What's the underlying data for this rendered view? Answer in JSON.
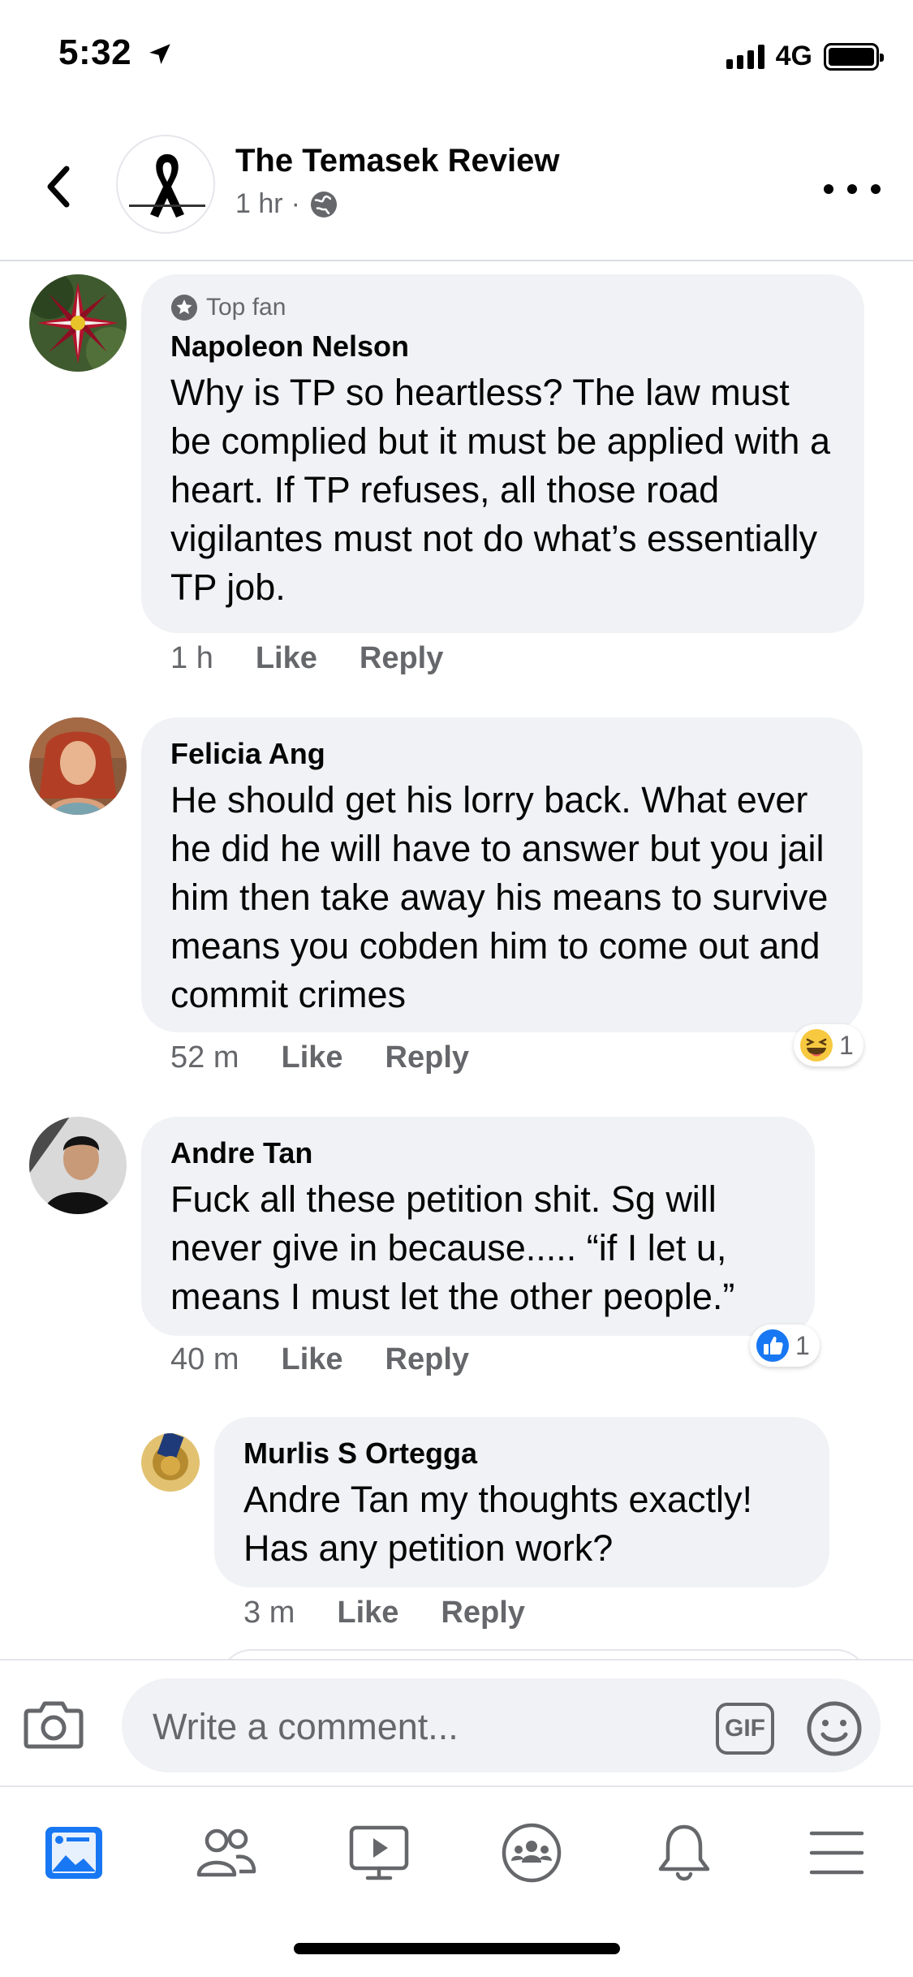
{
  "status_bar": {
    "time": "5:32",
    "network": "4G"
  },
  "header": {
    "page_name": "The Temasek Review",
    "post_time": "1 hr",
    "separator": "·",
    "icons": {
      "back": "chevron-left-icon",
      "privacy": "globe-icon",
      "more": "more-dots-icon"
    }
  },
  "comments": [
    {
      "badge": "Top fan",
      "author": "Napoleon Nelson",
      "text": "Why is TP so heartless? The law must be complied but it must be applied with a heart. If TP refuses,  all those road vigilantes must not do what’s essentially TP job.",
      "time": "1 h",
      "like_label": "Like",
      "reply_label": "Reply"
    },
    {
      "author": "Felicia Ang",
      "text": "He should get his lorry back. What ever he did he will have to answer but you jail him then take away his means to survive means you cobden him to come out and commit crimes",
      "time": "52 m",
      "like_label": "Like",
      "reply_label": "Reply",
      "reaction": {
        "type": "haha",
        "count": "1"
      }
    },
    {
      "author": "Andre Tan",
      "text": "Fuck all these petition shit. Sg will never give in because..... “if I let u, means I must let the other people.”",
      "time": "40 m",
      "like_label": "Like",
      "reply_label": "Reply",
      "reaction": {
        "type": "like",
        "count": "1"
      }
    }
  ],
  "reply": {
    "author": "Murlis S Ortegga",
    "text": "Andre Tan my thoughts exactly! Has any petition work?",
    "time": "3 m",
    "like_label": "Like",
    "reply_label": "Reply"
  },
  "composer": {
    "placeholder": "Write a comment...",
    "gif_label": "GIF"
  },
  "tabbar": [
    "news-feed-icon",
    "friends-icon",
    "watch-icon",
    "groups-icon",
    "notifications-icon",
    "menu-icon"
  ],
  "colors": {
    "bubble": "#f0f2f5",
    "secondary_text": "#65676b",
    "brand_blue": "#1877f2"
  }
}
